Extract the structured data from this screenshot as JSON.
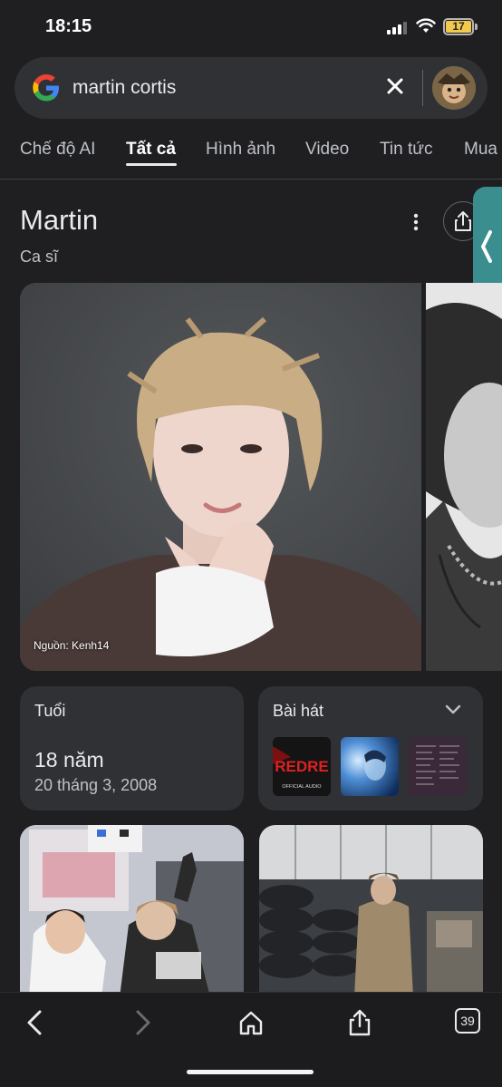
{
  "status_bar": {
    "time": "18:15",
    "battery": "17",
    "battery_color": "#f2c94c"
  },
  "search": {
    "query": "martin cortis",
    "logo_icon": "google-g-icon",
    "clear_icon": "close-icon"
  },
  "tabs": [
    {
      "label": "Chế độ AI",
      "active": false
    },
    {
      "label": "Tất cả",
      "active": true
    },
    {
      "label": "Hình ảnh",
      "active": false
    },
    {
      "label": "Video",
      "active": false
    },
    {
      "label": "Tin tức",
      "active": false
    },
    {
      "label": "Mua",
      "active": false
    }
  ],
  "knowledge_panel": {
    "title": "Martin",
    "subtitle": "Ca sĩ",
    "image_source": "Nguồn: Kenh14",
    "age_card": {
      "title": "Tuổi",
      "value": "18 năm",
      "birth_date": "20 tháng 3, 2008"
    },
    "songs_card": {
      "title": "Bài hát",
      "album_1_text": "REDRE",
      "album_1_caption": "OFFICIAL AUDIO"
    }
  },
  "toolbar": {
    "tab_count": "39"
  },
  "colors": {
    "background": "#1f1f22",
    "surface": "#303134",
    "accent_side_tab": "#3a8e8e"
  }
}
